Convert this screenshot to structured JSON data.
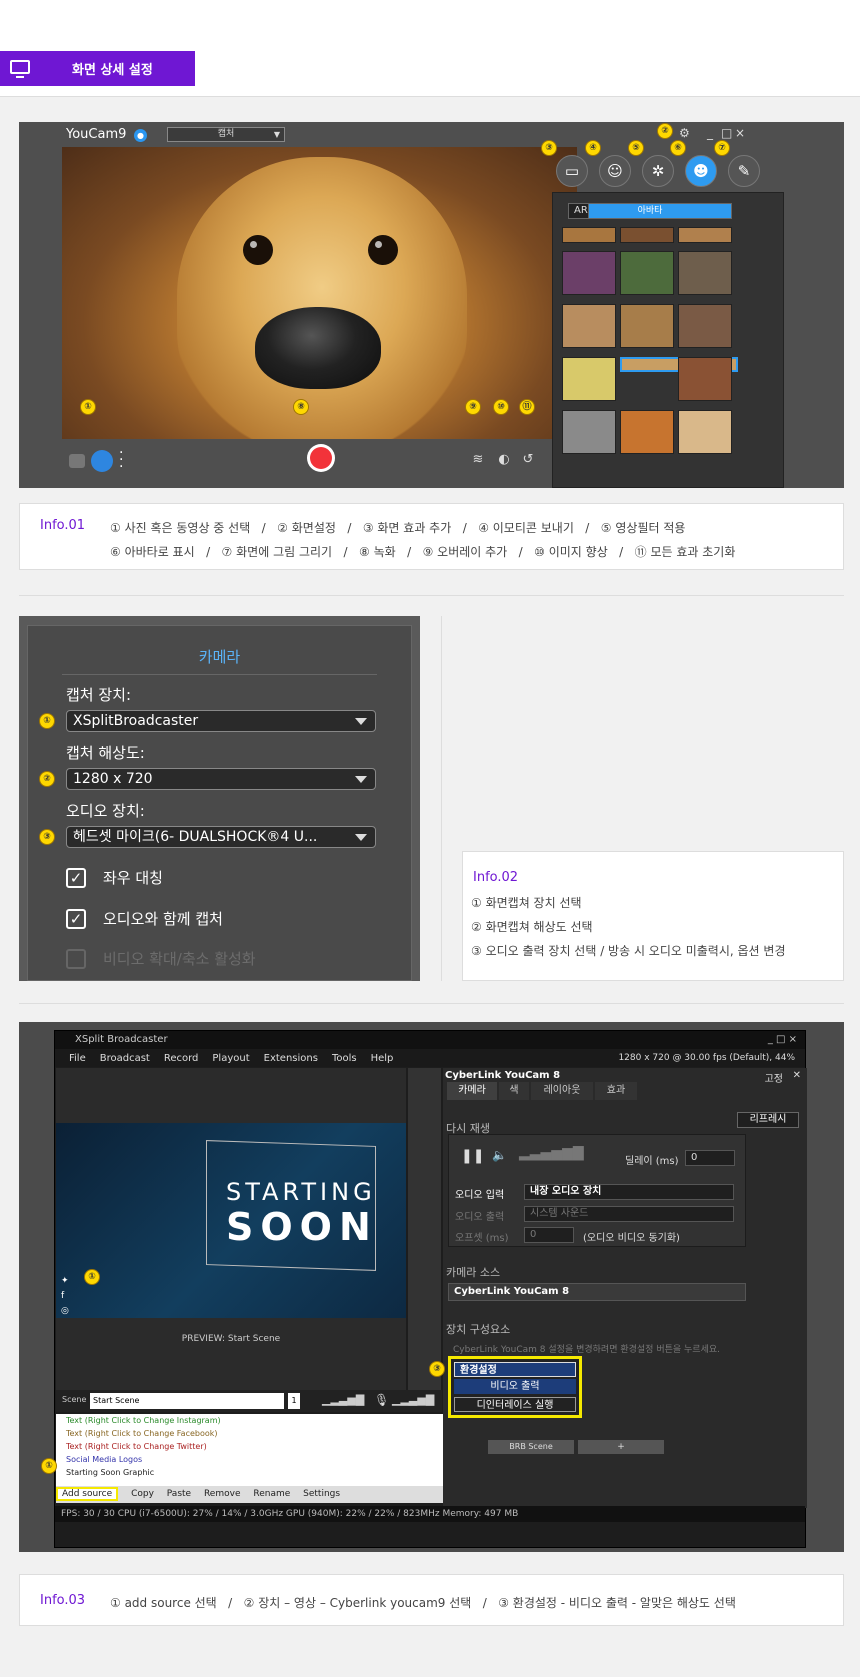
{
  "header": {
    "title": "화면 상세 설정",
    "icon": "monitor-icon"
  },
  "s1": {
    "app_title": "YouCam9",
    "mode_select": "캡처",
    "avatar_tabs": [
      "아바타",
      "AR"
    ],
    "badges": [
      "①",
      "②",
      "③",
      "④",
      "⑤",
      "⑥",
      "⑦",
      "⑧",
      "⑨",
      "⑩",
      "⑪"
    ]
  },
  "info1": {
    "tag": "Info.01",
    "line1": "① 사진 혹은 동영상 중 선택   /   ② 화면설정   /   ③ 화면 효과 추가   /   ④ 이모티콘 보내기   /   ⑤ 영상필터 적용",
    "line2": "⑥ 아바타로 표시   /   ⑦ 화면에 그림 그리기   /   ⑧ 녹화   /   ⑨ 오버레이 추가   /   ⑩ 이미지 향상   /   ⑪ 모든 효과 초기화"
  },
  "s2": {
    "heading": "카메라",
    "capture_device_label": "캡처 장치:",
    "capture_device_value": "XSplitBroadcaster",
    "resolution_label": "캡처 해상도:",
    "resolution_value": "1280 x 720",
    "audio_label": "오디오 장치:",
    "audio_value": "헤드셋 마이크(6- DUALSHOCK®4 U...",
    "mirror": "좌우 대칭",
    "audio_capture": "오디오와 함께 캡처",
    "zoom": "비디오 확대/축소 활성화",
    "badges": [
      "①",
      "②",
      "③"
    ]
  },
  "info2": {
    "tag": "Info.02",
    "line1": "① 화면캡쳐 장치 선택",
    "line2": "② 화면캡쳐 해상도 선택",
    "line3": "③ 오디오 출력 장치 선택 / 방송 시 오디오 미출력시, 옵션 변경"
  },
  "s3": {
    "app_title": "XSplit Broadcaster",
    "menu": [
      "File",
      "Broadcast",
      "Record",
      "Playout",
      "Extensions",
      "Tools",
      "Help"
    ],
    "resolution_info": "1280 x 720 @ 30.00 fps (Default), 44%",
    "preview_label": "PREVIEW:  Start Scene",
    "starting": "STARTING",
    "soon": "SOON",
    "scene_label": "Scene",
    "scene_value": "Start Scene",
    "scene_num": "1",
    "panel_title": "CyberLink YouCam 8",
    "pin_label": "고정",
    "tabs": [
      "카메라",
      "색",
      "레이아웃",
      "효과"
    ],
    "replay": "다시 재생",
    "refresh": "리프레시",
    "delay_label": "딜레이 (ms)",
    "delay_value": "0",
    "audio_in_label": "오디오 입력",
    "audio_in_value": "내장 오디오 장치",
    "audio_out_label": "오디오 출력",
    "audio_out_value": "시스템 사운드",
    "offset_label": "오프셋 (ms)",
    "offset_value": "0",
    "sync_label": "(오디오 비디오 동기화)",
    "camera_source": "카메라 소스",
    "camera_source_value": "CyberLink YouCam 8",
    "device_components": "장치 구성요소",
    "device_hint": "CyberLink YouCam 8 설정을 변경하려면 환경설정 버튼을 누르세요.",
    "settings_btn": "환경설정",
    "video_output": "비디오 출력",
    "deinterlace": "디인터레이스 실행",
    "brb_scene": "BRB Scene",
    "plus": "+",
    "sources": [
      "Text (Right Click to Change Instagram)",
      "Text (Right Click to Change Facebook)",
      "Text (Right Click to Change Twitter)",
      "Social Media Logos",
      "Starting Soon Graphic"
    ],
    "source_buttons": [
      "Add source",
      "Copy",
      "Paste",
      "Remove",
      "Rename",
      "Settings"
    ],
    "status": "FPS:  30 / 30      CPU (i7-6500U):  27% / 14% / 3.0GHz      GPU (940M):  22% / 22% / 823MHz      Memory:  497 MB",
    "badges": [
      "①",
      "①",
      "③"
    ]
  },
  "info3": {
    "tag": "Info.03",
    "line1": "① add source 선택   /   ② 장치 – 영상 – Cyberlink youcam9 선택   /   ③ 환경설정 - 비디오 출력 - 알맞은 해상도 선택"
  }
}
